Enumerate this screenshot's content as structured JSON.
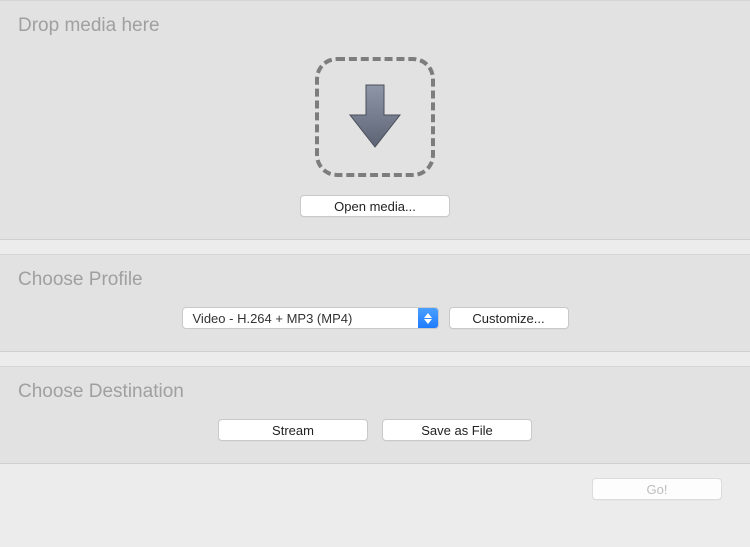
{
  "drop": {
    "title": "Drop media here",
    "open_media_label": "Open media..."
  },
  "profile": {
    "title": "Choose Profile",
    "selected": "Video - H.264 + MP3 (MP4)",
    "customize_label": "Customize..."
  },
  "destination": {
    "title": "Choose Destination",
    "stream_label": "Stream",
    "save_label": "Save as File"
  },
  "footer": {
    "go_label": "Go!"
  }
}
